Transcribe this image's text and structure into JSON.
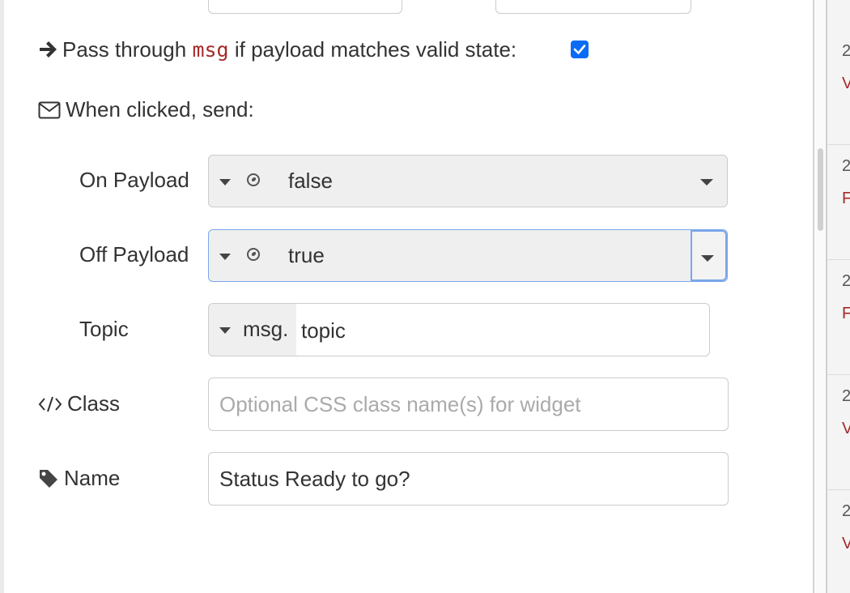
{
  "pass_through": {
    "prefix": "Pass through",
    "code": "msg",
    "suffix": "if payload matches valid state:",
    "checked": true
  },
  "when_clicked": {
    "label": "When clicked, send:"
  },
  "on_payload": {
    "label": "On Payload",
    "value": "false"
  },
  "off_payload": {
    "label": "Off Payload",
    "value": "true"
  },
  "topic": {
    "label": "Topic",
    "prefix": "msg.",
    "value": "topic"
  },
  "class_field": {
    "label": "Class",
    "placeholder": "Optional CSS class name(s) for widget",
    "value": ""
  },
  "name_field": {
    "label": "Name",
    "value": "Status Ready to go?"
  },
  "sidebar": {
    "entries": [
      {
        "num": "2",
        "text": "V"
      },
      {
        "num": "2",
        "text": "F"
      },
      {
        "num": "2",
        "text": "F"
      },
      {
        "num": "2",
        "text": "V"
      },
      {
        "num": "2",
        "text": "V"
      }
    ]
  },
  "colors": {
    "accent": "#0a6cf5",
    "focus": "#7aa6ea",
    "code": "#a52a2a"
  }
}
